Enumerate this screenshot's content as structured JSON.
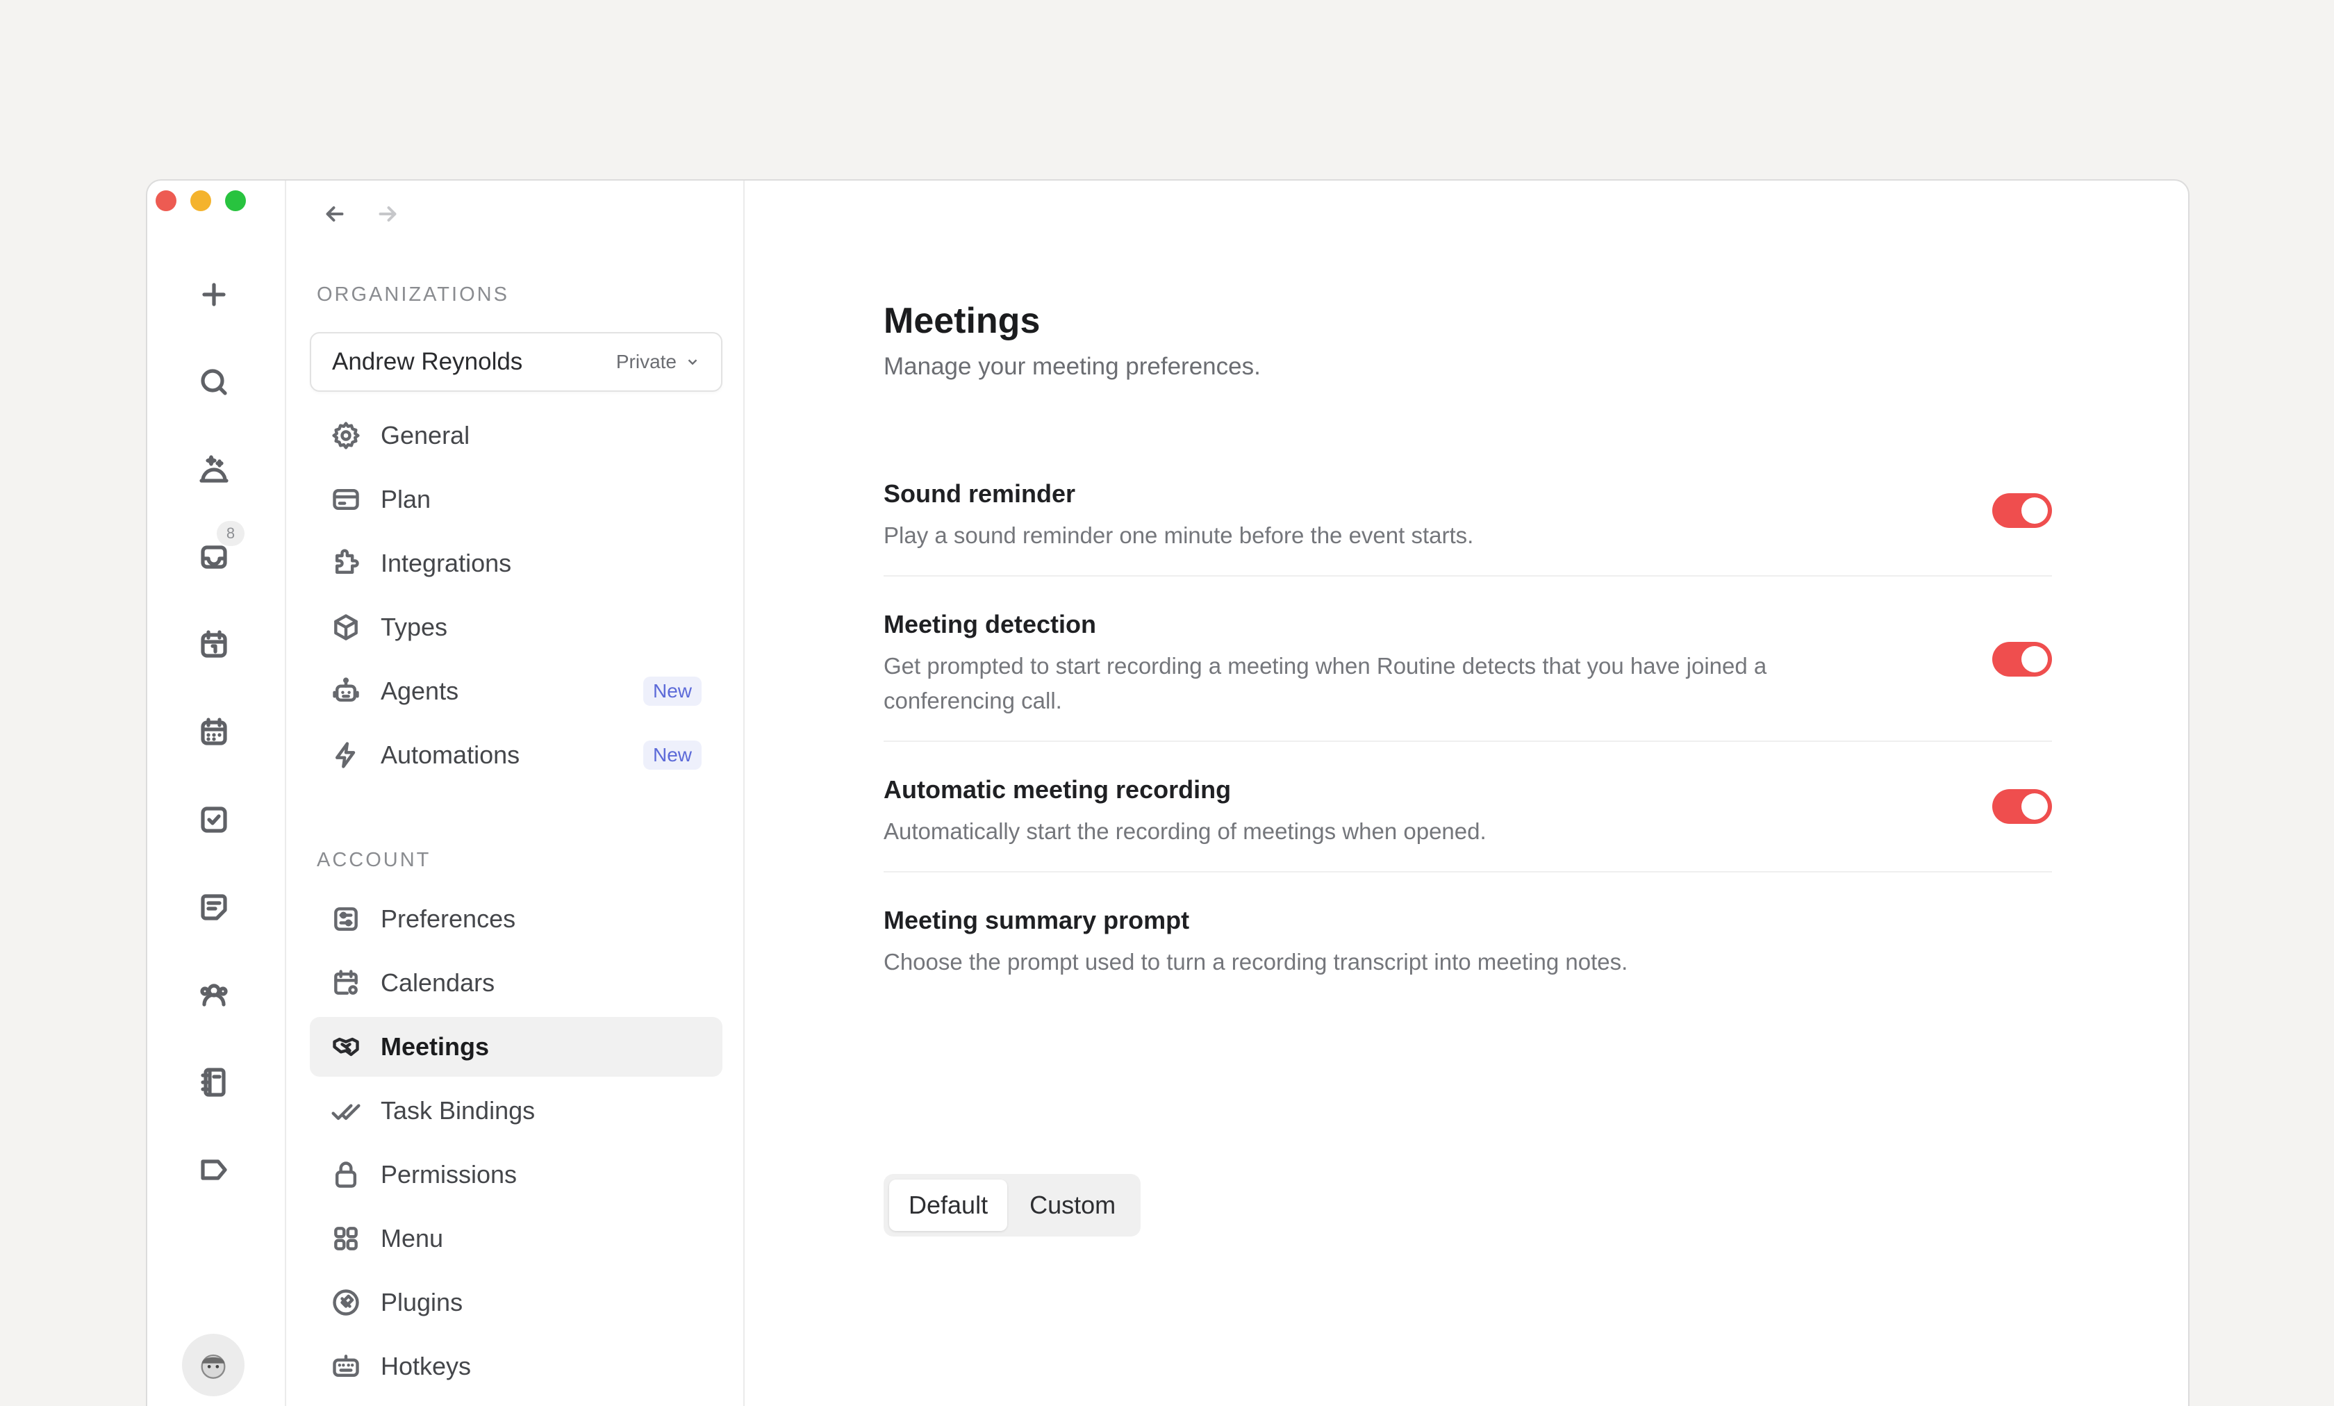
{
  "sidebar": {
    "organizations_label": "ORGANIZATIONS",
    "account_label": "ACCOUNT",
    "org": {
      "name": "Andrew Reynolds",
      "scope": "Private"
    },
    "org_items": [
      {
        "label": "General",
        "icon": "gear-icon"
      },
      {
        "label": "Plan",
        "icon": "card-icon"
      },
      {
        "label": "Integrations",
        "icon": "puzzle-icon"
      },
      {
        "label": "Types",
        "icon": "cube-icon"
      },
      {
        "label": "Agents",
        "icon": "robot-icon",
        "badge": "New"
      },
      {
        "label": "Automations",
        "icon": "bolt-icon",
        "badge": "New"
      }
    ],
    "account_items": [
      {
        "label": "Preferences",
        "icon": "sliders-icon"
      },
      {
        "label": "Calendars",
        "icon": "calendar-gear-icon"
      },
      {
        "label": "Meetings",
        "icon": "handshake-icon",
        "active": true
      },
      {
        "label": "Task Bindings",
        "icon": "double-check-icon"
      },
      {
        "label": "Permissions",
        "icon": "lock-icon"
      },
      {
        "label": "Menu",
        "icon": "grid-icon"
      },
      {
        "label": "Plugins",
        "icon": "plug-icon"
      },
      {
        "label": "Hotkeys",
        "icon": "keyboard-icon"
      }
    ]
  },
  "rail": {
    "inbox_badge": "8"
  },
  "main": {
    "title": "Meetings",
    "subtitle": "Manage your meeting preferences.",
    "settings": [
      {
        "title": "Sound reminder",
        "desc": "Play a sound reminder one minute before the event starts.",
        "enabled": true
      },
      {
        "title": "Meeting detection",
        "desc": "Get prompted to start recording a meeting when Routine detects that you have joined a conferencing call.",
        "enabled": true
      },
      {
        "title": "Automatic meeting recording",
        "desc": "Automatically start the recording of meetings when opened.",
        "enabled": true
      },
      {
        "title": "Meeting summary prompt",
        "desc": "Choose the prompt used to turn a recording transcript into meeting notes."
      }
    ],
    "prompt_options": [
      "Default",
      "Custom"
    ],
    "prompt_selected": "Default"
  },
  "colors": {
    "accent": "#ef4e4e",
    "badge": "#5c6ad8"
  }
}
